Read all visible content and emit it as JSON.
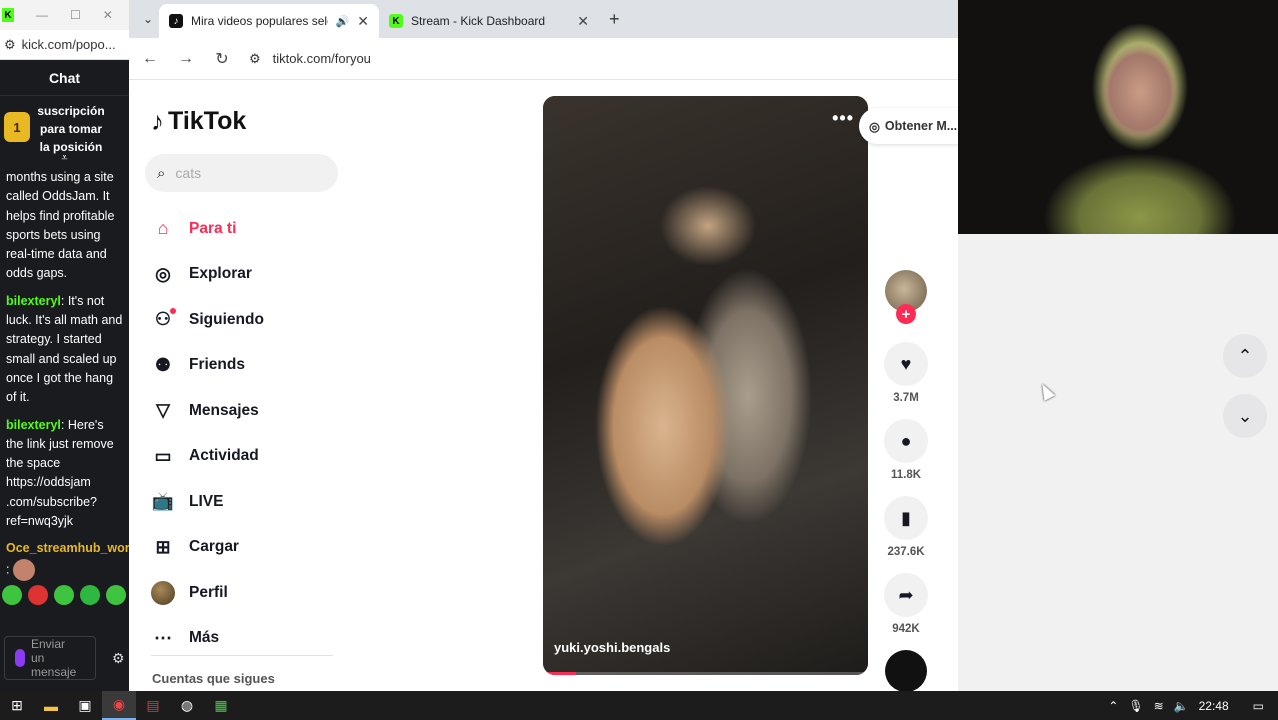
{
  "kick": {
    "url": "kick.com/popo...",
    "chat_title": "Chat",
    "sub_medal": "1",
    "sub_text": "suscripción para tomar la posición",
    "messages": [
      {
        "user": "",
        "text": "months using a site called OddsJam. It helps find profitable sports bets using real-time data and odds gaps."
      },
      {
        "user": "bilexteryl",
        "text": ": It's not luck. It's all math and strategy. I started small and scaled up once I got the hang of it."
      },
      {
        "user": "bilexteryl",
        "text": ": Here's the link just remove the space https://oddsjam .com/subscribe?ref=nwq3yjk"
      },
      {
        "user": "Oce_streamhub_wor",
        "text": ":"
      }
    ],
    "input_placeholder": "Enviar un mensaje"
  },
  "browser": {
    "tabs": [
      {
        "title": "Mira videos populares selec",
        "icon": "tiktok-icon",
        "active": true
      },
      {
        "title": "Stream - Kick Dashboard",
        "icon": "kick-icon",
        "active": false
      }
    ],
    "url": "tiktok.com/foryou"
  },
  "tiktok": {
    "logo": "TikTok",
    "search_placeholder": "cats",
    "nav": [
      {
        "label": "Para ti",
        "icon": "home-icon",
        "active": true
      },
      {
        "label": "Explorar",
        "icon": "compass-icon",
        "active": false
      },
      {
        "label": "Siguiendo",
        "icon": "following-icon",
        "active": false
      },
      {
        "label": "Friends",
        "icon": "friends-icon",
        "active": false
      },
      {
        "label": "Mensajes",
        "icon": "send-icon",
        "active": false
      },
      {
        "label": "Actividad",
        "icon": "inbox-icon",
        "active": false
      },
      {
        "label": "LIVE",
        "icon": "live-icon",
        "active": false
      },
      {
        "label": "Cargar",
        "icon": "upload-icon",
        "active": false
      },
      {
        "label": "Perfil",
        "icon": "profile-avatar",
        "active": false
      },
      {
        "label": "Más",
        "icon": "more-icon",
        "active": false
      }
    ],
    "accounts_heading": "Cuentas que sigues",
    "video": {
      "username": "yuki.yoshi.bengals",
      "progress": 0.1
    },
    "get_app": "Obtener M...",
    "actions": {
      "likes": "3.7M",
      "comments": "11.8K",
      "saves": "237.6K",
      "shares": "942K"
    },
    "accent": "#fe2c55"
  },
  "taskbar": {
    "time": "22:48"
  }
}
